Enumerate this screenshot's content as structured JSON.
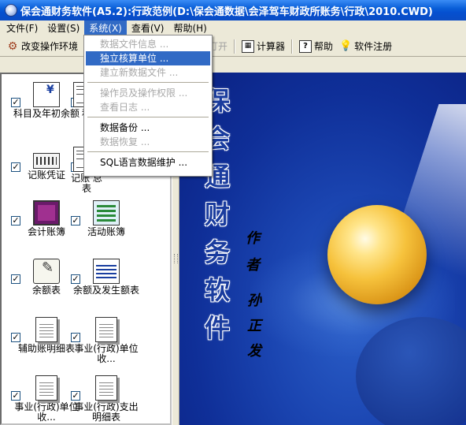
{
  "window": {
    "title": "保会通财务软件(A5.2):行政范例(D:\\保会通数据\\会泽驾车财政所账务\\行政\\2010.CWD)"
  },
  "menubar": {
    "items": [
      {
        "label": "文件(F)"
      },
      {
        "label": "设置(S)"
      },
      {
        "label": "系统(X)"
      },
      {
        "label": "查看(V)"
      },
      {
        "label": "帮助(H)"
      }
    ]
  },
  "system_menu": {
    "items": [
      {
        "label": "数据文件信息 ...",
        "state": "disabled"
      },
      {
        "label": "独立核算单位 ...",
        "state": "selected"
      },
      {
        "label": "建立新数据文件 ...",
        "state": "disabled"
      },
      {
        "label": "操作员及操作权限 ...",
        "state": "disabled"
      },
      {
        "label": "查看日志 ...",
        "state": "disabled"
      },
      {
        "label": "数据备份 ...",
        "state": "enabled"
      },
      {
        "label": "数据恢复 ...",
        "state": "disabled"
      },
      {
        "label": "SQL语言数据维护 ...",
        "state": "enabled"
      }
    ]
  },
  "toolbar": {
    "change_env": "改变操作环境",
    "open": "打开",
    "calculator": "计算器",
    "help": "帮助",
    "register": "软件注册"
  },
  "modules": [
    {
      "label": "科目及年初余额",
      "icon": "ledger-pen-icon",
      "checked": true
    },
    {
      "label": "科",
      "icon": "ledger-icon",
      "checked": true
    },
    {
      "label": "记账凭证",
      "icon": "keyboard-icon",
      "checked": true
    },
    {
      "label": "记账 总表",
      "icon": "ledger-icon",
      "checked": true
    },
    {
      "label": "会计账簿",
      "icon": "book-icon",
      "checked": true
    },
    {
      "label": "活动账簿",
      "icon": "activity-icon",
      "checked": true
    },
    {
      "label": "余额表",
      "icon": "scroll-icon",
      "checked": true
    },
    {
      "label": "余额及发生额表",
      "icon": "chart-icon",
      "checked": true
    },
    {
      "label": "辅助账明细表",
      "icon": "document-icon",
      "checked": true
    },
    {
      "label": "事业(行政)单位收...",
      "icon": "document-icon",
      "checked": true
    },
    {
      "label": "事业(行政)单位收...",
      "icon": "document-icon",
      "checked": true
    },
    {
      "label": "事业(行政)支出明细表",
      "icon": "document-icon",
      "checked": true
    }
  ],
  "splash": {
    "brand": "保会通财务软件",
    "author_label": "作者",
    "author_name": "孙正发"
  },
  "colors": {
    "titlebar": "#0a5fd8",
    "menu_highlight": "#316ac5",
    "splash_bg": "#1a44b0",
    "brand_text": "#1a3c9e"
  }
}
